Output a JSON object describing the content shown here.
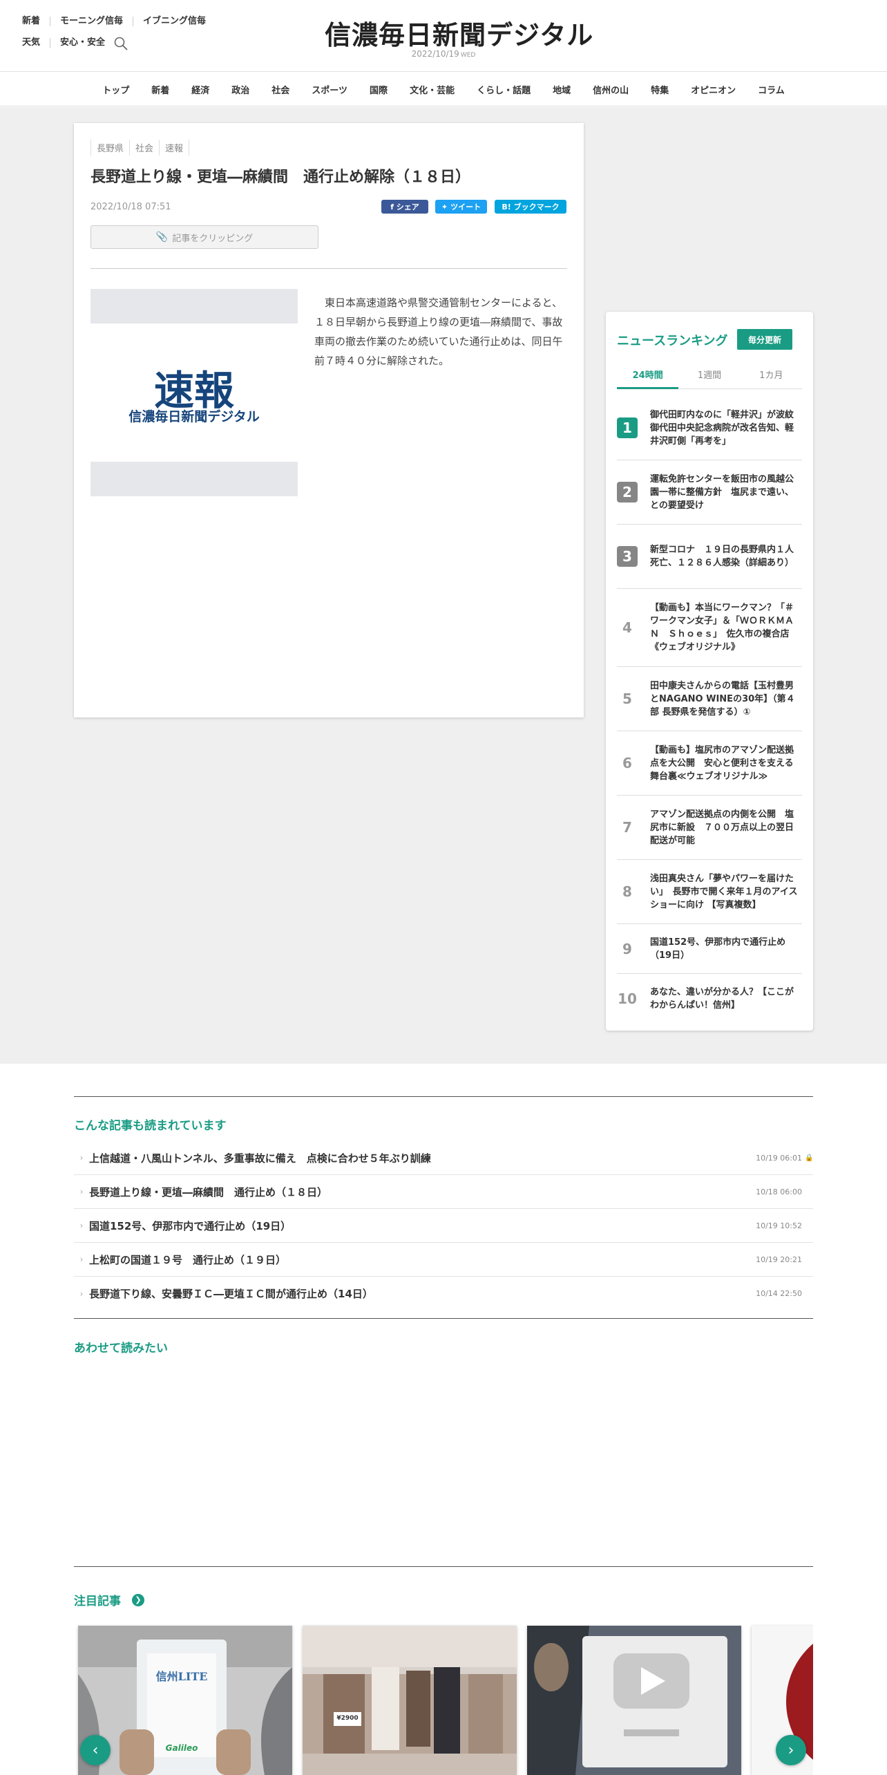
{
  "header": {
    "util_row1": [
      "新着",
      "モーニング信毎",
      "イブニング信毎"
    ],
    "util_row2": [
      "天気",
      "安心・安全"
    ],
    "logo": "信濃毎日新聞デジタル",
    "date": "2022/10/19",
    "weekday": "WED"
  },
  "nav": [
    "トップ",
    "新着",
    "経済",
    "政治",
    "社会",
    "スポーツ",
    "国際",
    "文化・芸能",
    "くらし・話題",
    "地域",
    "信州の山",
    "特集",
    "オピニオン",
    "コラム"
  ],
  "article": {
    "tags": [
      "長野県",
      "社会",
      "速報"
    ],
    "headline": "長野道上り線・更埴―麻績間　通行止め解除（１８日）",
    "pubdate": "2022/10/18 07:51",
    "share_fb": "f シェア",
    "share_tw": "ツイート",
    "share_hb": "B! ブックマーク",
    "clip_label": "記事をクリッピング",
    "image_main": "速報",
    "image_sub": "信濃毎日新聞デジタル",
    "body": "　東日本高速道路や県警交通管制センターによると、１８日早朝から長野道上り線の更埴―麻績間で、事故車両の撤去作業のため続いていた通行止めは、同日午前７時４０分に解除された。"
  },
  "ranking": {
    "title": "ニュースランキング",
    "badge": "毎分更新",
    "tabs": [
      "24時間",
      "1週間",
      "1カ月"
    ],
    "items": [
      {
        "num": "1",
        "text": "御代田町内なのに「軽井沢」が波紋　御代田中央記念病院が改名告知、軽井沢町側「再考を」"
      },
      {
        "num": "2",
        "text": "運転免許センターを飯田市の風越公園一帯に整備方針　塩尻まで遠い、との要望受け"
      },
      {
        "num": "3",
        "text": "新型コロナ　１９日の長野県内１人死亡、１２８６人感染（詳細あり）"
      },
      {
        "num": "4",
        "text": "【動画も】本当にワークマン？「＃ワークマン女子」＆「ＷＯＲＫＭＡＮ　Ｓｈｏｅｓ」　佐久市の複合店《ウェブオリジナル》"
      },
      {
        "num": "5",
        "text": "田中康夫さんからの電話【玉村豊男とNAGANO WINEの30年】（第４部 長野県を発信する）①"
      },
      {
        "num": "6",
        "text": "【動画も】塩尻市のアマゾン配送拠点を大公開　安心と便利さを支える舞台裏≪ウェブオリジナル≫"
      },
      {
        "num": "7",
        "text": "アマゾン配送拠点の内側を公開　塩尻市に新設　７００万点以上の翌日配送が可能"
      },
      {
        "num": "8",
        "text": "浅田真央さん「夢やパワーを届けたい」　長野市で開く来年１月のアイスショーに向け 【写真複数】"
      },
      {
        "num": "9",
        "text": "国道152号、伊那市内で通行止め（19日）"
      },
      {
        "num": "10",
        "text": "あなた、違いが分かる人？【ここがわからんぱい！信州】"
      }
    ]
  },
  "related": {
    "title": "こんな記事も読まれています",
    "items": [
      {
        "title": "上信越道・八風山トンネル、多重事故に備え　点検に合わせ５年ぶり訓練",
        "date": "10/19 06:01",
        "locked": true
      },
      {
        "title": "長野道上り線・更埴―麻績間　通行止め（１８日）",
        "date": "10/18 06:00",
        "locked": false
      },
      {
        "title": "国道152号、伊那市内で通行止め（19日）",
        "date": "10/19 10:52",
        "locked": false
      },
      {
        "title": "上松町の国道１９号　通行止め（１９日）",
        "date": "10/19 20:21",
        "locked": false
      },
      {
        "title": "長野道下り線、安曇野ＩＣ―更埴ＩＣ間が通行止め（14日）",
        "date": "10/14 22:50",
        "locked": false
      }
    ]
  },
  "also_read": {
    "title": "あわせて読みたい"
  },
  "attention": {
    "title": "注目記事",
    "card1_phone_label": "信州LITE",
    "card1_brand": "Galileo",
    "card2_price": "¥2900"
  },
  "colors": {
    "accent": "#1a9c84",
    "navy": "#16457c",
    "facebook": "#3b5998",
    "twitter": "#1da1f2",
    "hatena": "#00a4de"
  }
}
